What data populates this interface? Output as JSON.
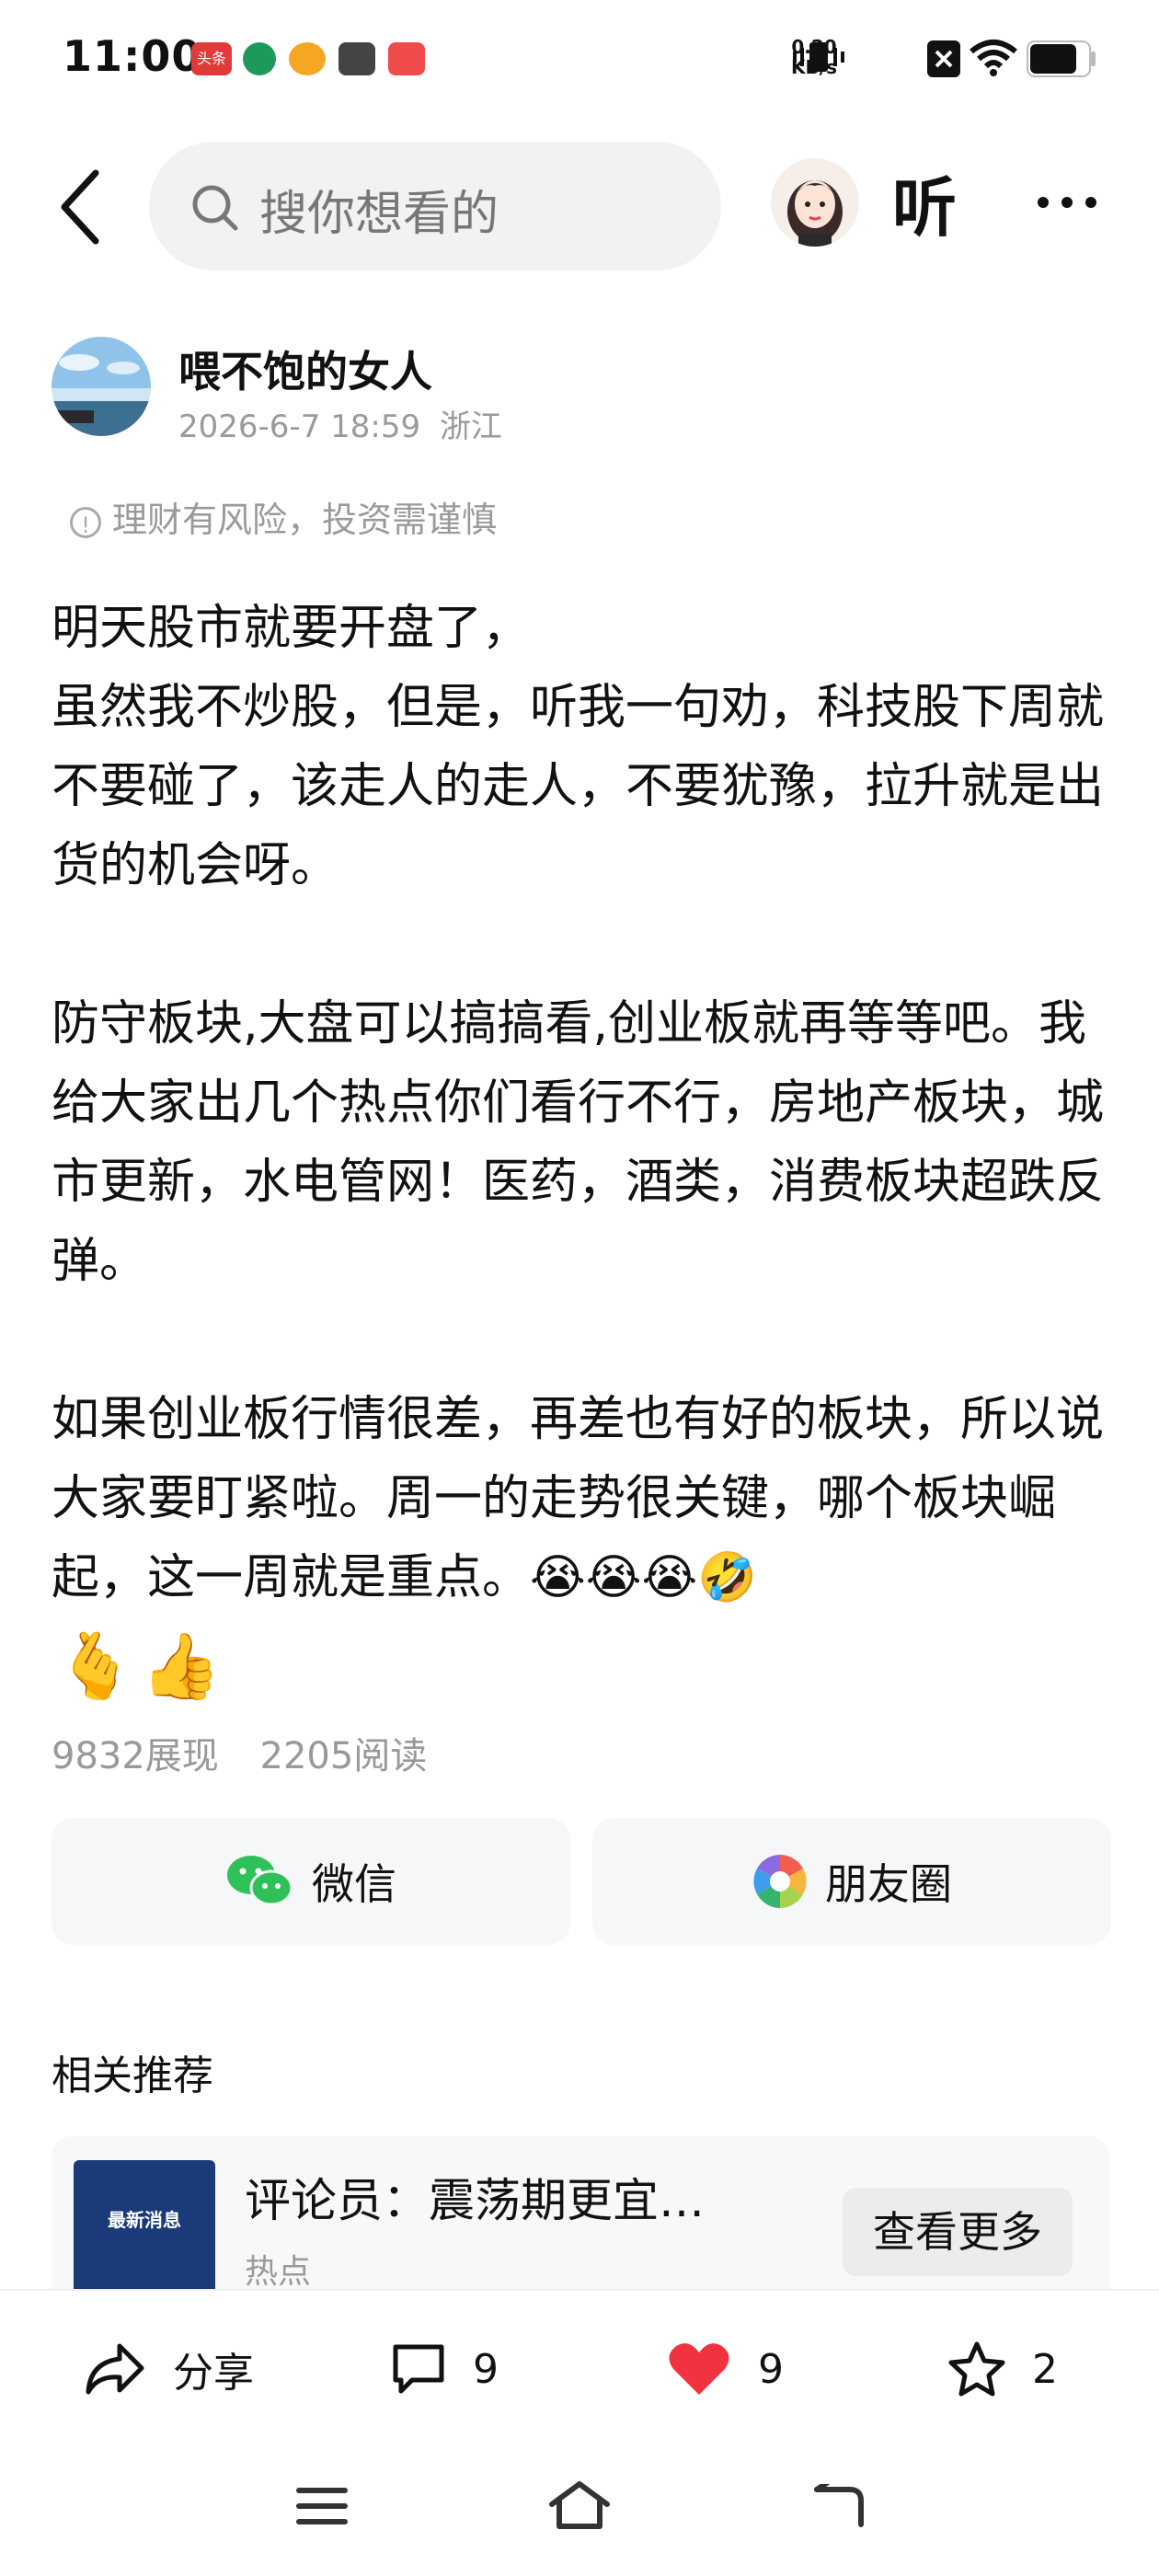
{
  "status_bar": {
    "time": "11:00",
    "apps": [
      {
        "name": "toutiao-app-icon",
        "label": "头条",
        "color": "#e03a3a"
      },
      {
        "name": "bank-app-icon",
        "label": "",
        "color": "#1d9a5a"
      },
      {
        "name": "weibo-app-icon",
        "label": "",
        "color": "#f5a623"
      },
      {
        "name": "game-app-icon",
        "label": "",
        "color": "#444444"
      },
      {
        "name": "douyin-app-icon",
        "label": "",
        "color": "#ef4b4b"
      }
    ],
    "net_speed_value": "0.20",
    "net_speed_unit": "KB/s"
  },
  "top_bar": {
    "search_placeholder": "搜你想看的",
    "listen_label": "听"
  },
  "author": {
    "name": "喂不饱的女人",
    "datetime": "2026-6-7 18:59",
    "location": "浙江"
  },
  "risk_notice": "理财有风险，投资需谨慎",
  "article": {
    "paragraphs": [
      "明天股市就要开盘了，",
      "虽然我不炒股，但是，听我一句劝，科技股下周就不要碰了，该走人的走人，不要犹豫，拉升就是出货的机会呀。",
      "",
      "防守板块,大盘可以搞搞看,创业板就再等等吧。我给大家出几个热点你们看行不行，房地产板块，城市更新，水电管网！医药，酒类，消费板块超跌反弹。",
      "",
      "如果创业板行情很差，再差也有好的板块，所以说大家要盯紧啦。周一的走势很关键，哪个板块崛起，这一周就是重点。😭😭😭🤣"
    ],
    "emoji_line": "🫰👍"
  },
  "stats": {
    "impressions": "9832展现",
    "reads": "2205阅读"
  },
  "share": {
    "wechat_label": "微信",
    "moments_label": "朋友圈"
  },
  "related": {
    "section_title": "相关推荐",
    "thumb_text": "最新消息",
    "headline": "评论员：震荡期更宜…",
    "tag": "热点",
    "see_more_label": "查看更多"
  },
  "actions": {
    "share_label": "分享",
    "comments_count": "9",
    "likes_count": "9",
    "favorites_count": "2",
    "like_color": "#f0333f"
  }
}
